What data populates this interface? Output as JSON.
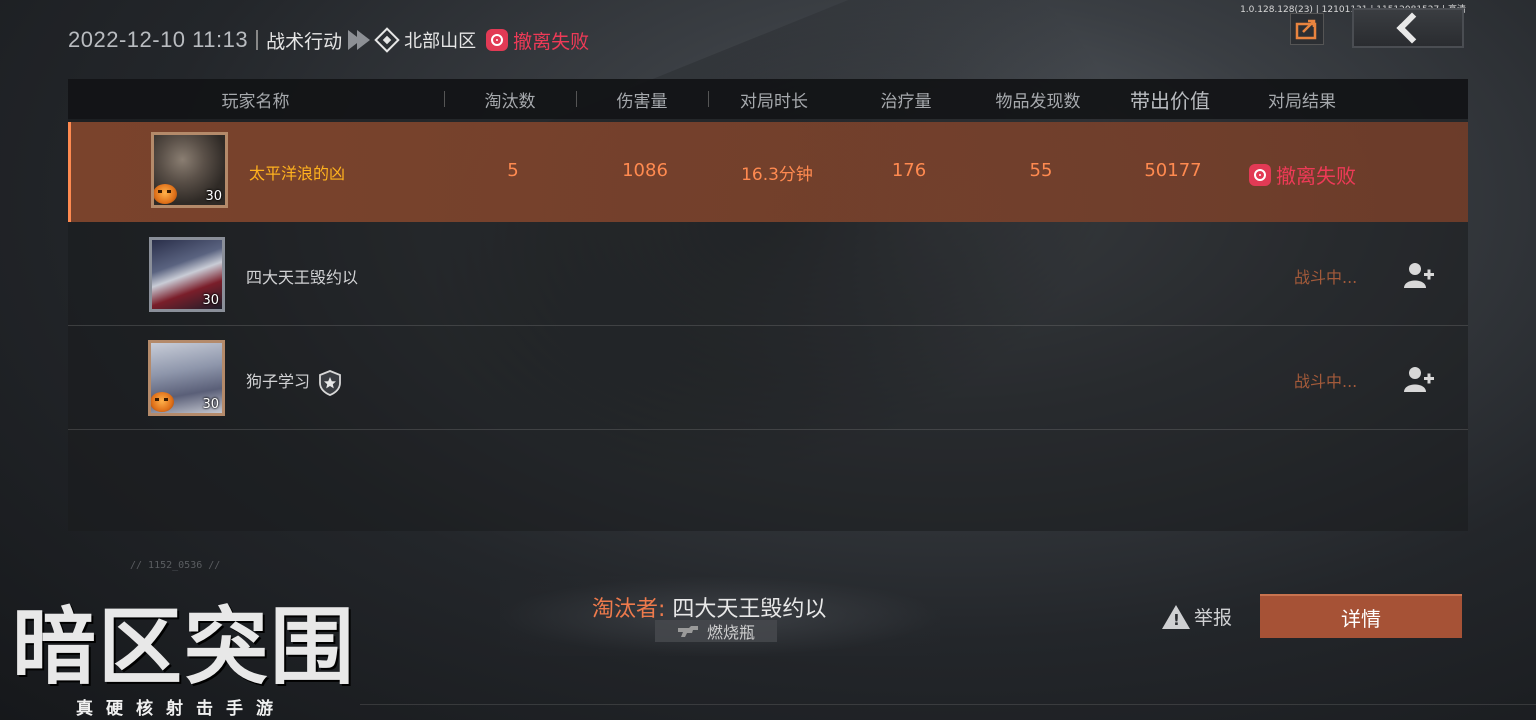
{
  "version": "1.0.128.128(23) | 12101131 | 11512081527 | 高清",
  "header": {
    "datetime": "2022-12-10 11:13",
    "mode": "战术行动",
    "map": "北部山区",
    "result": "撤离失败"
  },
  "colors": {
    "accent_orange": "#ff8a50",
    "fail_red": "#ee3a57",
    "self_row": "#82462d",
    "detail_button": "#a65236"
  },
  "table": {
    "headers": [
      "玩家名称",
      "淘汰数",
      "伤害量",
      "对局时长",
      "治疗量",
      "物品发现数",
      "带出价值",
      "对局结果"
    ],
    "rows": [
      {
        "name": "太平洋浪的凶",
        "level": "30",
        "kills": "5",
        "damage": "1086",
        "duration": "16.3分钟",
        "healing": "176",
        "items": "55",
        "value": "50177",
        "result": "撤离失败",
        "icon": "halloween-pumpkin-badge"
      },
      {
        "name": "四大天王毁约以",
        "level": "30",
        "status": "战斗中...",
        "icon": "add-friend-icon"
      },
      {
        "name": "狗子学习",
        "level": "30",
        "status": "战斗中...",
        "icon": "add-friend-icon",
        "badge": "shield-star-icon"
      }
    ]
  },
  "killer": {
    "label": "淘汰者:",
    "name": "四大天王毁约以",
    "weapon": "燃烧瓶"
  },
  "footer": {
    "coords": "// 1152_0536 //",
    "report_label": "举报",
    "detail_label": "详情"
  },
  "logo": {
    "title": "暗区突围",
    "subtitle": "真硬核射击手游"
  }
}
